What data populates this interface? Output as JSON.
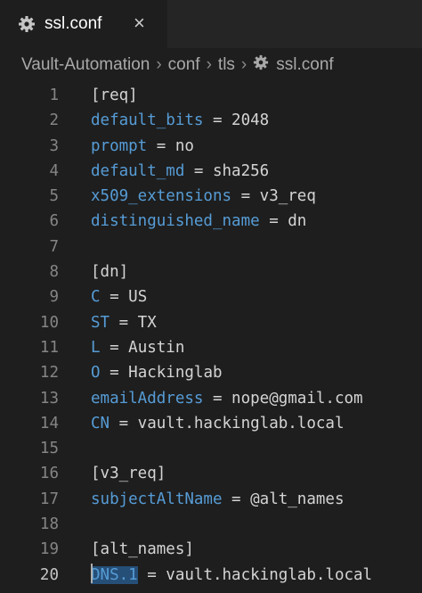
{
  "tab": {
    "label": "ssl.conf",
    "close": "×",
    "icon": "gear-icon"
  },
  "breadcrumb": [
    {
      "label": "Vault-Automation"
    },
    {
      "label": "conf"
    },
    {
      "label": "tls"
    },
    {
      "label": "ssl.conf",
      "icon": "gear-icon"
    }
  ],
  "breadcrumb_separator": "›",
  "editor": {
    "active_line": 20,
    "lines": [
      {
        "n": "1",
        "key": "",
        "rest": "[req]"
      },
      {
        "n": "2",
        "key": "default_bits",
        "rest": " = 2048"
      },
      {
        "n": "3",
        "key": "prompt",
        "rest": " = no"
      },
      {
        "n": "4",
        "key": "default_md",
        "rest": " = sha256"
      },
      {
        "n": "5",
        "key": "x509_extensions",
        "rest": " = v3_req"
      },
      {
        "n": "6",
        "key": "distinguished_name",
        "rest": " = dn"
      },
      {
        "n": "7",
        "key": "",
        "rest": ""
      },
      {
        "n": "8",
        "key": "",
        "rest": "[dn]"
      },
      {
        "n": "9",
        "key": "C",
        "rest": " = US"
      },
      {
        "n": "10",
        "key": "ST",
        "rest": " = TX"
      },
      {
        "n": "11",
        "key": "L",
        "rest": " = Austin"
      },
      {
        "n": "12",
        "key": "O",
        "rest": " = Hackinglab"
      },
      {
        "n": "13",
        "key": "emailAddress",
        "rest": " = nope@gmail.com"
      },
      {
        "n": "14",
        "key": "CN",
        "rest": " = vault.hackinglab.local"
      },
      {
        "n": "15",
        "key": "",
        "rest": ""
      },
      {
        "n": "16",
        "key": "",
        "rest": "[v3_req]"
      },
      {
        "n": "17",
        "key": "subjectAltName",
        "rest": " = @alt_names"
      },
      {
        "n": "18",
        "key": "",
        "rest": ""
      },
      {
        "n": "19",
        "key": "",
        "rest": "[alt_names]"
      },
      {
        "n": "20",
        "key": "DNS.1",
        "rest": " = vault.hackinglab.local",
        "selected": true
      }
    ]
  },
  "colors": {
    "key": "#569cd6",
    "text": "#d4d4d4",
    "selection": "#264f78",
    "background": "#1e1e1e"
  }
}
